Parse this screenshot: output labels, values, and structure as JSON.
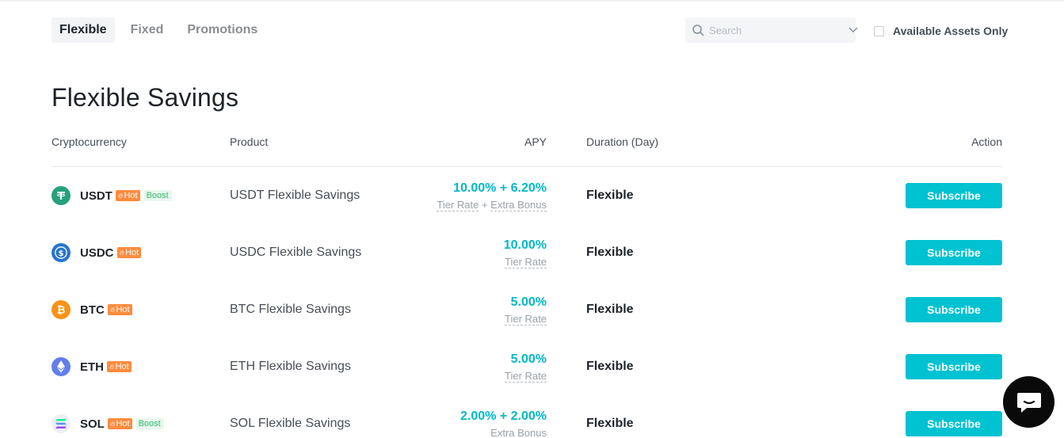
{
  "tabs": [
    {
      "label": "Flexible",
      "active": true
    },
    {
      "label": "Fixed",
      "active": false
    },
    {
      "label": "Promotions",
      "active": false
    }
  ],
  "search": {
    "placeholder": "Search",
    "value": ""
  },
  "filter": {
    "label": "Available Assets Only",
    "checked": false
  },
  "page_title": "Flexible Savings",
  "columns": {
    "cryptocurrency": "Cryptocurrency",
    "product": "Product",
    "apy": "APY",
    "duration": "Duration (Day)",
    "action": "Action"
  },
  "rows": [
    {
      "symbol": "USDT",
      "hot": "Hot",
      "boost": "Boost",
      "product": "USDT Flexible Savings",
      "apy": "10.00% + 6.20%",
      "sub_a": "Tier Rate",
      "sub_join": " + ",
      "sub_b": "Extra Bonus",
      "duration": "Flexible",
      "action": "Subscribe",
      "icon": "tether-icon",
      "color": "#26a17b"
    },
    {
      "symbol": "USDC",
      "hot": "Hot",
      "boost": "",
      "product": "USDC Flexible Savings",
      "apy": "10.00%",
      "sub_a": "Tier Rate",
      "sub_join": "",
      "sub_b": "",
      "duration": "Flexible",
      "action": "Subscribe",
      "icon": "usdc-icon",
      "color": "#2775ca"
    },
    {
      "symbol": "BTC",
      "hot": "Hot",
      "boost": "",
      "product": "BTC Flexible Savings",
      "apy": "5.00%",
      "sub_a": "Tier Rate",
      "sub_join": "",
      "sub_b": "",
      "duration": "Flexible",
      "action": "Subscribe",
      "icon": "bitcoin-icon",
      "color": "#f7931a"
    },
    {
      "symbol": "ETH",
      "hot": "Hot",
      "boost": "",
      "product": "ETH Flexible Savings",
      "apy": "5.00%",
      "sub_a": "Tier Rate",
      "sub_join": "",
      "sub_b": "",
      "duration": "Flexible",
      "action": "Subscribe",
      "icon": "ethereum-icon",
      "color": "#627eea"
    },
    {
      "symbol": "SOL",
      "hot": "Hot",
      "boost": "Boost",
      "product": "SOL Flexible Savings",
      "apy": "2.00% + 2.00%",
      "sub_a": "",
      "sub_join": "",
      "sub_b": "Extra Bonus",
      "duration": "Flexible",
      "action": "Subscribe",
      "icon": "solana-icon",
      "color": "#9945ff"
    }
  ],
  "chat": {
    "icon": "chat-bubble-icon"
  },
  "colors": {
    "accent": "#00c2d1",
    "apy": "#00b8c8",
    "hot": "#ff8b3d",
    "boost": "#2ebd6b"
  }
}
